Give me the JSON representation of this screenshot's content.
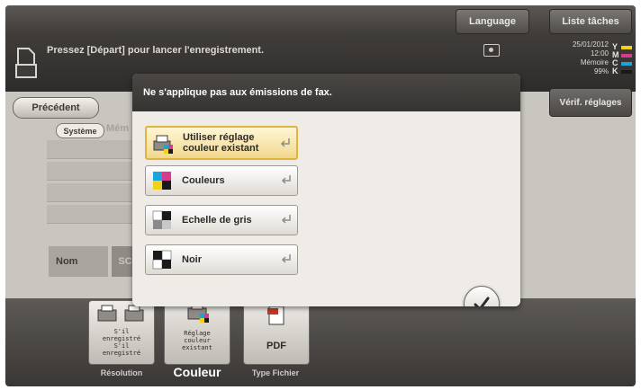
{
  "topbar": {
    "language_label": "Language",
    "job_list_label": "Liste tâches"
  },
  "message": {
    "text": "Pressez [Départ] pour lancer l'enregistrement."
  },
  "status": {
    "date": "25/01/2012",
    "time": "12:00",
    "memory_label": "Mémoire",
    "memory_value": "99%",
    "toner_letters": [
      "Y",
      "M",
      "C",
      "K"
    ],
    "toner_colors": [
      "#f2d11b",
      "#d63b8f",
      "#1ca3d9",
      "#1a1a1a"
    ]
  },
  "background": {
    "precedent_label": "Précédent",
    "systeme_tab": "Système",
    "memoire_tab": "Mém",
    "nom_label": "Nom",
    "nom_value": "SC",
    "verif_label": "Vérif. réglages"
  },
  "dialog": {
    "message": "Ne s'applique pas aux émissions de fax.",
    "options": [
      {
        "line1": "Utiliser réglage",
        "line2": "couleur existant",
        "icon": "printer-color-icon",
        "selected": true
      },
      {
        "line1": "Couleurs",
        "line2": "",
        "icon": "color-squares-icon",
        "selected": false
      },
      {
        "line1": "Echelle de gris",
        "line2": "",
        "icon": "grayscale-icon",
        "selected": false
      },
      {
        "line1": "Noir",
        "line2": "",
        "icon": "black-icon",
        "selected": false
      }
    ]
  },
  "bottom": {
    "resolution_tile_lines": [
      "S'il",
      "enregistré",
      "S'il",
      "enregistré"
    ],
    "resolution_label": "Résolution",
    "color_tile_lines": [
      "Réglage",
      "couleur",
      "existant"
    ],
    "color_label": "Couleur",
    "filetype_tile_value": "PDF",
    "filetype_label": "Type Fichier"
  }
}
